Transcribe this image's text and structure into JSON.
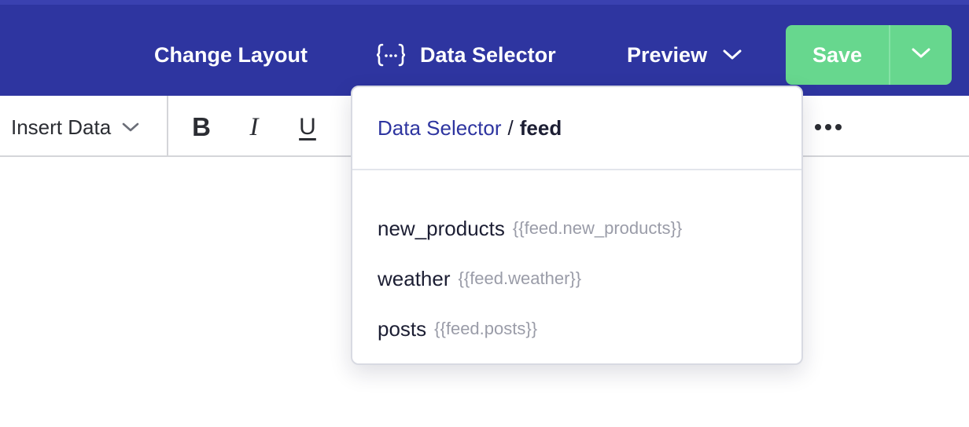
{
  "topbar": {
    "change_layout_label": "Change Layout",
    "data_selector_label": "Data Selector",
    "preview_label": "Preview",
    "save_label": "Save"
  },
  "toolbar": {
    "insert_data_label": "Insert Data",
    "bold_label": "B",
    "italic_label": "I",
    "underline_label": "U"
  },
  "dropdown": {
    "breadcrumb": {
      "root": "Data Selector",
      "separator": "/",
      "current": "feed"
    },
    "items": [
      {
        "key": "new_products",
        "path": "{{feed.new_products}}"
      },
      {
        "key": "weather",
        "path": "{{feed.weather}}"
      },
      {
        "key": "posts",
        "path": "{{feed.posts}}"
      }
    ]
  },
  "colors": {
    "header_bg": "#2e35a0",
    "save_green": "#67d78e",
    "link_blue": "#2e35a0",
    "muted_text": "#9a9ca8"
  },
  "icons": {
    "data_selector": "curly-braces-icon",
    "preview": "chevron-down-icon",
    "save_menu": "chevron-down-icon",
    "insert_data": "chevron-down-icon",
    "more": "more-horizontal-icon"
  }
}
